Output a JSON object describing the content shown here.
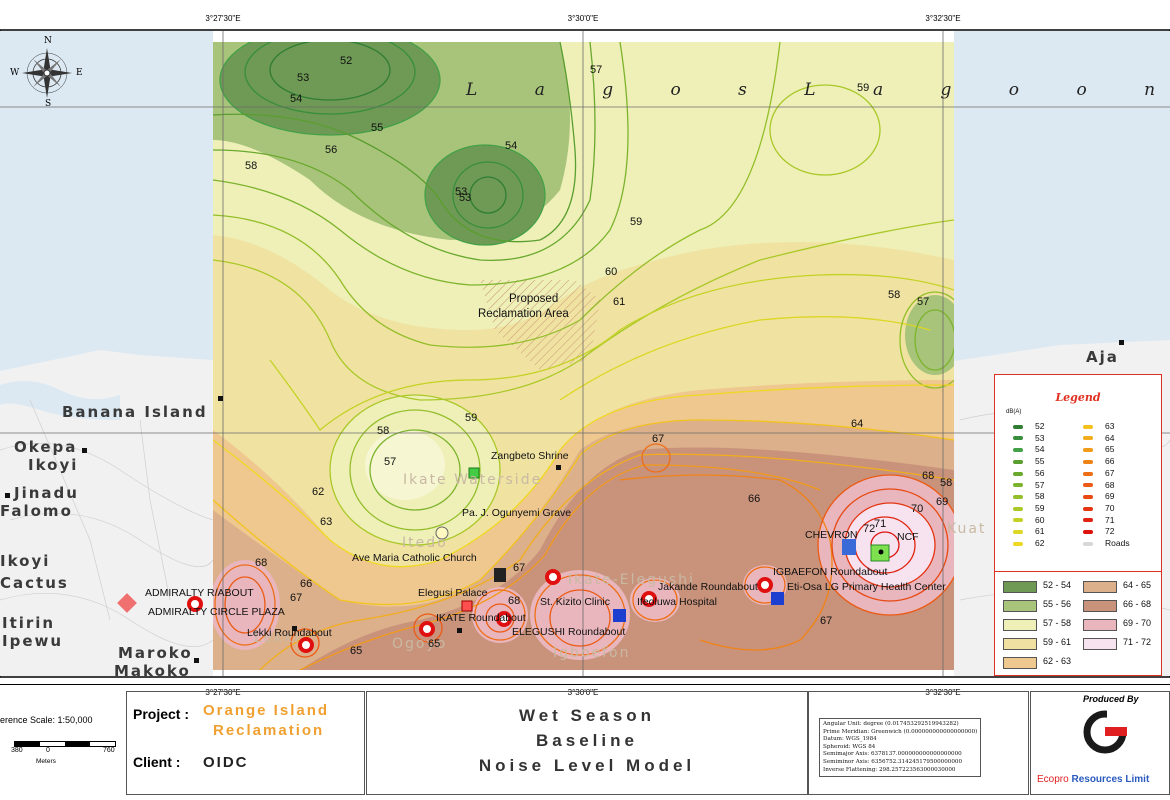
{
  "map": {
    "coord_labels_top": [
      "3°27'30\"E",
      "3°30'0\"E",
      "3°32'30\"E"
    ],
    "coord_labels_bottom": [
      "3°27'30\"E",
      "3°30'0\"E",
      "3°32'30\"E"
    ],
    "compass": {
      "n": "N",
      "s": "S",
      "e": "E",
      "w": "W"
    },
    "water_label": "L a g o s   L a g o o n",
    "reclamation_label_1": "Proposed",
    "reclamation_label_2": "Reclamation Area",
    "places": {
      "aja": "Aja",
      "banana_island": "Banana Island",
      "okepa": "Okepa",
      "ikoyi": "Ikoyi",
      "jinadu": "Jinadu",
      "falomo": "Falomo",
      "ikoyi_cut": "Ikoyi",
      "cactus": "Cactus",
      "itirin": "Itirin",
      "ipewu": "Ipewu",
      "maroko": "Maroko",
      "makoko": "Makoko",
      "ikate_waterside": "Ikate Waterside",
      "itedo": "Itedo",
      "ikate_elegushi": "Ikate-Elegushi",
      "igboefon": "Igboefon",
      "ogoyo": "Ogoyo",
      "lekki": "Lekki",
      "kuat": "Kuat"
    },
    "pois": {
      "zangbeto": "Zangbeto Shrine",
      "ogunyemi": "Pa. J. Ogunyemi Grave",
      "ave_maria": "Ave Maria Catholic Church",
      "admiralty_rab": "ADMIRALTY R/ABOUT",
      "admiralty_plaza": "ADMIRALTY CIRCLE PLAZA",
      "lekki_rab": "Lekki Roundabout",
      "elegusi_palace": "Elegusi Palace",
      "ikate_rab": "IKATE Roundabout",
      "elegushi_rab": "ELEGUSHI Roundabout",
      "st_kizito": "St. Kizito Clinic",
      "ifeoluwa": "Ifeoluwa Hospital",
      "jakande_rab": "Jakande Roundabout",
      "igbaefon_rab": "IGBAEFON Roundabout",
      "eti_osa_phc": "Eti-Osa LG Primary Health Center",
      "chevron": "CHEVRON",
      "ncf": "NCF"
    },
    "contour_labels": [
      "52",
      "53",
      "54",
      "53",
      "55",
      "56",
      "58",
      "54",
      "53",
      "57",
      "59",
      "60",
      "61",
      "58",
      "57",
      "59",
      "58",
      "59",
      "57",
      "62",
      "63",
      "64",
      "66",
      "67",
      "68",
      "69",
      "70",
      "71",
      "72",
      "65",
      "67",
      "68",
      "66",
      "67",
      "65",
      "67",
      "58",
      "68"
    ]
  },
  "legend": {
    "title": "Legend",
    "unit": "dB(A)",
    "col1": [
      {
        "label": "52",
        "color": "#2e7d32"
      },
      {
        "label": "53",
        "color": "#388e3c"
      },
      {
        "label": "54",
        "color": "#43a047"
      },
      {
        "label": "55",
        "color": "#5a9e2f"
      },
      {
        "label": "56",
        "color": "#6aa82e"
      },
      {
        "label": "57",
        "color": "#7cb32c"
      },
      {
        "label": "58",
        "color": "#94be2a"
      },
      {
        "label": "59",
        "color": "#aac828"
      },
      {
        "label": "60",
        "color": "#c4d226"
      },
      {
        "label": "61",
        "color": "#dcd624"
      },
      {
        "label": "62",
        "color": "#f0d822"
      }
    ],
    "col2": [
      {
        "label": "63",
        "color": "#f3c21e"
      },
      {
        "label": "64",
        "color": "#f3ad1c"
      },
      {
        "label": "65",
        "color": "#f29a1a"
      },
      {
        "label": "66",
        "color": "#f08318"
      },
      {
        "label": "67",
        "color": "#ee6e16"
      },
      {
        "label": "68",
        "color": "#ec5a14"
      },
      {
        "label": "69",
        "color": "#e84812"
      },
      {
        "label": "70",
        "color": "#e43410"
      },
      {
        "label": "71",
        "color": "#e0220e"
      },
      {
        "label": "72",
        "color": "#dc120c"
      },
      {
        "label": "Roads",
        "color": "#d8d8d8"
      }
    ],
    "classes": [
      {
        "label": "52 - 54",
        "color": "#6f9a55"
      },
      {
        "label": "64 - 65",
        "color": "#dcb08a"
      },
      {
        "label": "55 - 56",
        "color": "#a8c47a"
      },
      {
        "label": "66 - 68",
        "color": "#c9927b"
      },
      {
        "label": "57 - 58",
        "color": "#eef0b8"
      },
      {
        "label": "69 - 70",
        "color": "#e8b6bc"
      },
      {
        "label": "59 - 61",
        "color": "#f0e1a2"
      },
      {
        "label": "71 - 72",
        "color": "#f7e3ef"
      },
      {
        "label": "62 - 63",
        "color": "#eec88e"
      }
    ]
  },
  "footer": {
    "scale_text": "erence Scale: 1:50,000",
    "scale_ticks": [
      "380",
      "0",
      "760"
    ],
    "scale_unit": "Meters",
    "project_label": "Project :",
    "project_name_1": "Orange Island",
    "project_name_2": "Reclamation",
    "client_label": "Client :",
    "client_name": "OIDC",
    "title_1": "Wet Season",
    "title_2": "Baseline",
    "title_3": "Noise Level Model",
    "spatial": [
      "Angular Unit: degree (0.017453292519943282)",
      "Prime Meridian: Greenwich (0.000000000000000000)",
      "Datum: WGS_1984",
      "Spheroid: WGS 84",
      "Semimajor Axis: 6378137.000000000000000000",
      "Semiminor Axis: 6356752.314245179500000000",
      "Inverse Flattening: 298.257223563000030000"
    ],
    "produced_by": "Produced By",
    "company_1": "Ecopro",
    "company_2": "Resources",
    "company_3": "Limit"
  }
}
